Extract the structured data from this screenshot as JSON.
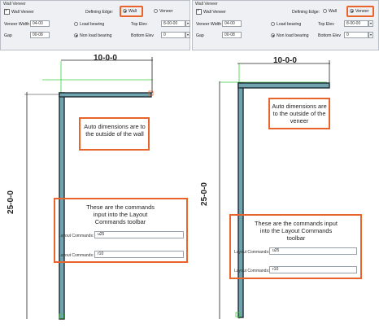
{
  "panels": [
    {
      "title": "Wall Veneer",
      "wall_veneer_checkbox": "Wall Veneer",
      "defining_edge_label": "Defining Edge:",
      "option_wall": "Wall",
      "option_veneer": "Veneer",
      "selected_edge": "wall",
      "veneer_width_label": "Veneer Width",
      "veneer_width_value": "04-00",
      "gap_label": "Gap",
      "gap_value": "00-08",
      "load_bearing": "Load bearing",
      "non_load_bearing": "Non load bearing",
      "top_elev_label": "Top Elev",
      "top_elev_value": "8-00-00",
      "bottom_elev_label": "Bottom Elev",
      "bottom_elev_value": "0"
    },
    {
      "title": "Wall Veneer",
      "wall_veneer_checkbox": "Wall Veneer",
      "defining_edge_label": "Defining Edge:",
      "option_wall": "Wall",
      "option_veneer": "Veneer",
      "selected_edge": "veneer",
      "veneer_width_label": "Veneer Width",
      "veneer_width_value": "04-00",
      "gap_label": "Gap",
      "gap_value": "00-08",
      "load_bearing": "Load bearing",
      "non_load_bearing": "Non load bearing",
      "top_elev_label": "Top Elev",
      "top_elev_value": "8-00-00",
      "bottom_elev_label": "Bottom Elev",
      "bottom_elev_value": "0"
    }
  ],
  "drawings": [
    {
      "horizontal_dim": "10-0-0",
      "vertical_dim": "25-0-0",
      "auto_note": "Auto dimensions are to the outside of the wall",
      "commands_note": "These are the commands input into the Layout Commands toolbar",
      "command_label": "Layout Commands:",
      "command_1": "u25",
      "command_2": "r10"
    },
    {
      "horizontal_dim": "10-0-0",
      "vertical_dim": "25-0-0",
      "auto_note": "Auto dimensions are to the outside of the veneer",
      "commands_note": "These are the commands input into the Layout Commands toolbar",
      "command_label": "Layout Commands:",
      "command_1": "u25",
      "command_2": "r10"
    }
  ],
  "colors": {
    "highlight": "#e8642a",
    "wall_fill": "#6fa3b0",
    "wall_edge": "#1e2a33",
    "guide": "#3ccf3c"
  }
}
